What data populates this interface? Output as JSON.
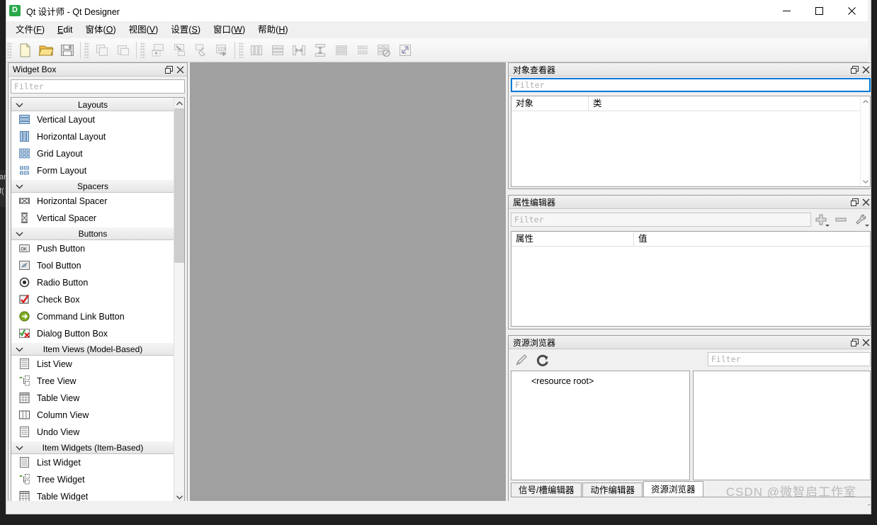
{
  "window": {
    "title": "Qt 设计师 - Qt Designer",
    "app_icon": "qt-designer-icon",
    "minimize_label": "minimize",
    "maximize_label": "maximize",
    "close_label": "close"
  },
  "menubar": {
    "items": [
      {
        "label": "文件(F)",
        "mnemonic": "F"
      },
      {
        "label": "Edit",
        "mnemonic": "E"
      },
      {
        "label": "窗体(O)",
        "mnemonic": "O"
      },
      {
        "label": "视图(V)",
        "mnemonic": "V"
      },
      {
        "label": "设置(S)",
        "mnemonic": "S"
      },
      {
        "label": "窗口(W)",
        "mnemonic": "W"
      },
      {
        "label": "帮助(H)",
        "mnemonic": "H"
      }
    ]
  },
  "toolbar": {
    "groups": [
      {
        "name": "file",
        "buttons": [
          {
            "icon": "new-form-icon",
            "enabled": true
          },
          {
            "icon": "open-folder-icon",
            "enabled": true
          },
          {
            "icon": "save-icon",
            "enabled": true
          }
        ]
      },
      {
        "name": "edit",
        "buttons": [
          {
            "icon": "copy-icon",
            "enabled": false
          },
          {
            "icon": "paste-icon",
            "enabled": false
          }
        ]
      },
      {
        "name": "modes",
        "buttons": [
          {
            "icon": "edit-widgets-icon",
            "enabled": false
          },
          {
            "icon": "edit-signals-slots-icon",
            "enabled": false
          },
          {
            "icon": "edit-buddies-icon",
            "enabled": false
          },
          {
            "icon": "edit-tab-order-icon",
            "enabled": false
          }
        ]
      },
      {
        "name": "layout",
        "buttons": [
          {
            "icon": "layout-horizontal-icon",
            "enabled": false
          },
          {
            "icon": "layout-vertical-icon",
            "enabled": false
          },
          {
            "icon": "layout-splitter-horizontal-icon",
            "enabled": false
          },
          {
            "icon": "layout-splitter-vertical-icon",
            "enabled": false
          },
          {
            "icon": "layout-grid-icon",
            "enabled": false
          },
          {
            "icon": "layout-form-icon",
            "enabled": false
          },
          {
            "icon": "break-layout-icon",
            "enabled": false
          },
          {
            "icon": "adjust-size-icon",
            "enabled": false
          }
        ]
      }
    ]
  },
  "widget_box": {
    "title": "Widget Box",
    "filter_placeholder": "Filter",
    "filter_value": "",
    "float_label": "float",
    "close_label": "close",
    "groups": [
      {
        "name": "Layouts",
        "expanded": true,
        "items": [
          {
            "label": "Vertical Layout",
            "icon": "vertical-layout-icon"
          },
          {
            "label": "Horizontal Layout",
            "icon": "horizontal-layout-icon"
          },
          {
            "label": "Grid Layout",
            "icon": "grid-layout-icon"
          },
          {
            "label": "Form Layout",
            "icon": "form-layout-icon"
          }
        ]
      },
      {
        "name": "Spacers",
        "expanded": true,
        "items": [
          {
            "label": "Horizontal Spacer",
            "icon": "horizontal-spacer-icon"
          },
          {
            "label": "Vertical Spacer",
            "icon": "vertical-spacer-icon"
          }
        ]
      },
      {
        "name": "Buttons",
        "expanded": true,
        "items": [
          {
            "label": "Push Button",
            "icon": "push-button-icon"
          },
          {
            "label": "Tool Button",
            "icon": "tool-button-icon"
          },
          {
            "label": "Radio Button",
            "icon": "radio-button-icon"
          },
          {
            "label": "Check Box",
            "icon": "check-box-icon"
          },
          {
            "label": "Command Link Button",
            "icon": "command-link-button-icon"
          },
          {
            "label": "Dialog Button Box",
            "icon": "dialog-button-box-icon"
          }
        ]
      },
      {
        "name": "Item Views (Model-Based)",
        "expanded": true,
        "items": [
          {
            "label": "List View",
            "icon": "list-view-icon"
          },
          {
            "label": "Tree View",
            "icon": "tree-view-icon"
          },
          {
            "label": "Table View",
            "icon": "table-view-icon"
          },
          {
            "label": "Column View",
            "icon": "column-view-icon"
          },
          {
            "label": "Undo View",
            "icon": "undo-view-icon"
          }
        ]
      },
      {
        "name": "Item Widgets (Item-Based)",
        "expanded": true,
        "items": [
          {
            "label": "List Widget",
            "icon": "list-widget-icon"
          },
          {
            "label": "Tree Widget",
            "icon": "tree-widget-icon"
          },
          {
            "label": "Table Widget",
            "icon": "table-widget-icon"
          }
        ]
      }
    ]
  },
  "object_inspector": {
    "title": "对象查看器",
    "filter_placeholder": "Filter",
    "filter_value": "",
    "filter_focused": true,
    "columns": [
      "对象",
      "类"
    ],
    "rows": []
  },
  "property_editor": {
    "title": "属性编辑器",
    "filter_placeholder": "Filter",
    "filter_value": "",
    "columns": [
      "属性",
      "值"
    ],
    "rows": [],
    "buttons": [
      {
        "icon": "add-property-icon",
        "label": "添加"
      },
      {
        "icon": "remove-property-icon",
        "label": "移除"
      },
      {
        "icon": "configure-icon",
        "label": "配置"
      }
    ]
  },
  "resource_browser": {
    "title": "资源浏览器",
    "filter_placeholder": "Filter",
    "filter_value": "",
    "buttons": [
      {
        "icon": "edit-resources-icon",
        "label": "编辑资源"
      },
      {
        "icon": "reload-icon",
        "label": "重新载入"
      }
    ],
    "tree_root": "<resource root>",
    "preview_items": [],
    "tabs": [
      {
        "label": "信号/槽编辑器",
        "active": false
      },
      {
        "label": "动作编辑器",
        "active": false
      },
      {
        "label": "资源浏览器",
        "active": true
      }
    ]
  },
  "watermark": "CSDN @微智启工作室",
  "artifact": {
    "line1": "ar",
    "line2": "f("
  },
  "colors": {
    "canvas": "#a0a0a0",
    "panel": "#f0f0f0",
    "accent": "#0078d7",
    "app_icon": "#2aa84a"
  }
}
